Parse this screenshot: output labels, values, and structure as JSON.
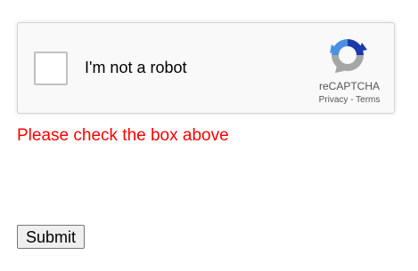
{
  "recaptcha": {
    "checkbox_label": "I'm not a robot",
    "checked": false,
    "brand": "reCAPTCHA",
    "privacy_label": "Privacy",
    "separator": " - ",
    "terms_label": "Terms",
    "icon": "recaptcha-logo-icon",
    "colors": {
      "blue": "#1c3aa9",
      "light_blue": "#4a90e2",
      "gray": "#a6a6a6",
      "border": "#d3d3d3",
      "background": "#f9f9f9"
    }
  },
  "error": {
    "message": "Please check the box above",
    "color": "#ff0000"
  },
  "form": {
    "submit_label": "Submit"
  }
}
